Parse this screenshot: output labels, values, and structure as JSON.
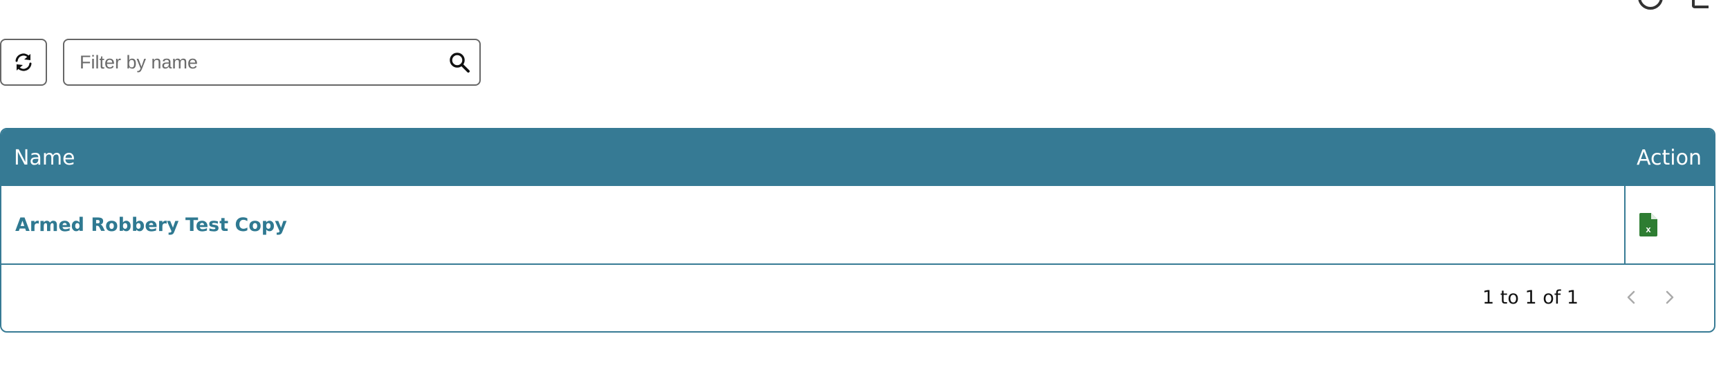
{
  "toolbar": {
    "refresh_icon": "refresh-icon",
    "search": {
      "placeholder": "Filter by name",
      "value": "",
      "icon": "search-icon"
    }
  },
  "grid": {
    "columns": [
      "Name",
      "Action"
    ],
    "rows": [
      {
        "name": "Armed Robbery Test Copy",
        "action_icon": "excel-file-icon"
      }
    ],
    "pager": {
      "summary": "1 to 1 of 1",
      "prev_icon": "chevron-left-icon",
      "next_icon": "chevron-right-icon"
    }
  },
  "colors": {
    "header_bg": "#367a94",
    "link": "#2f7991",
    "excel_green": "#2e7d32"
  }
}
